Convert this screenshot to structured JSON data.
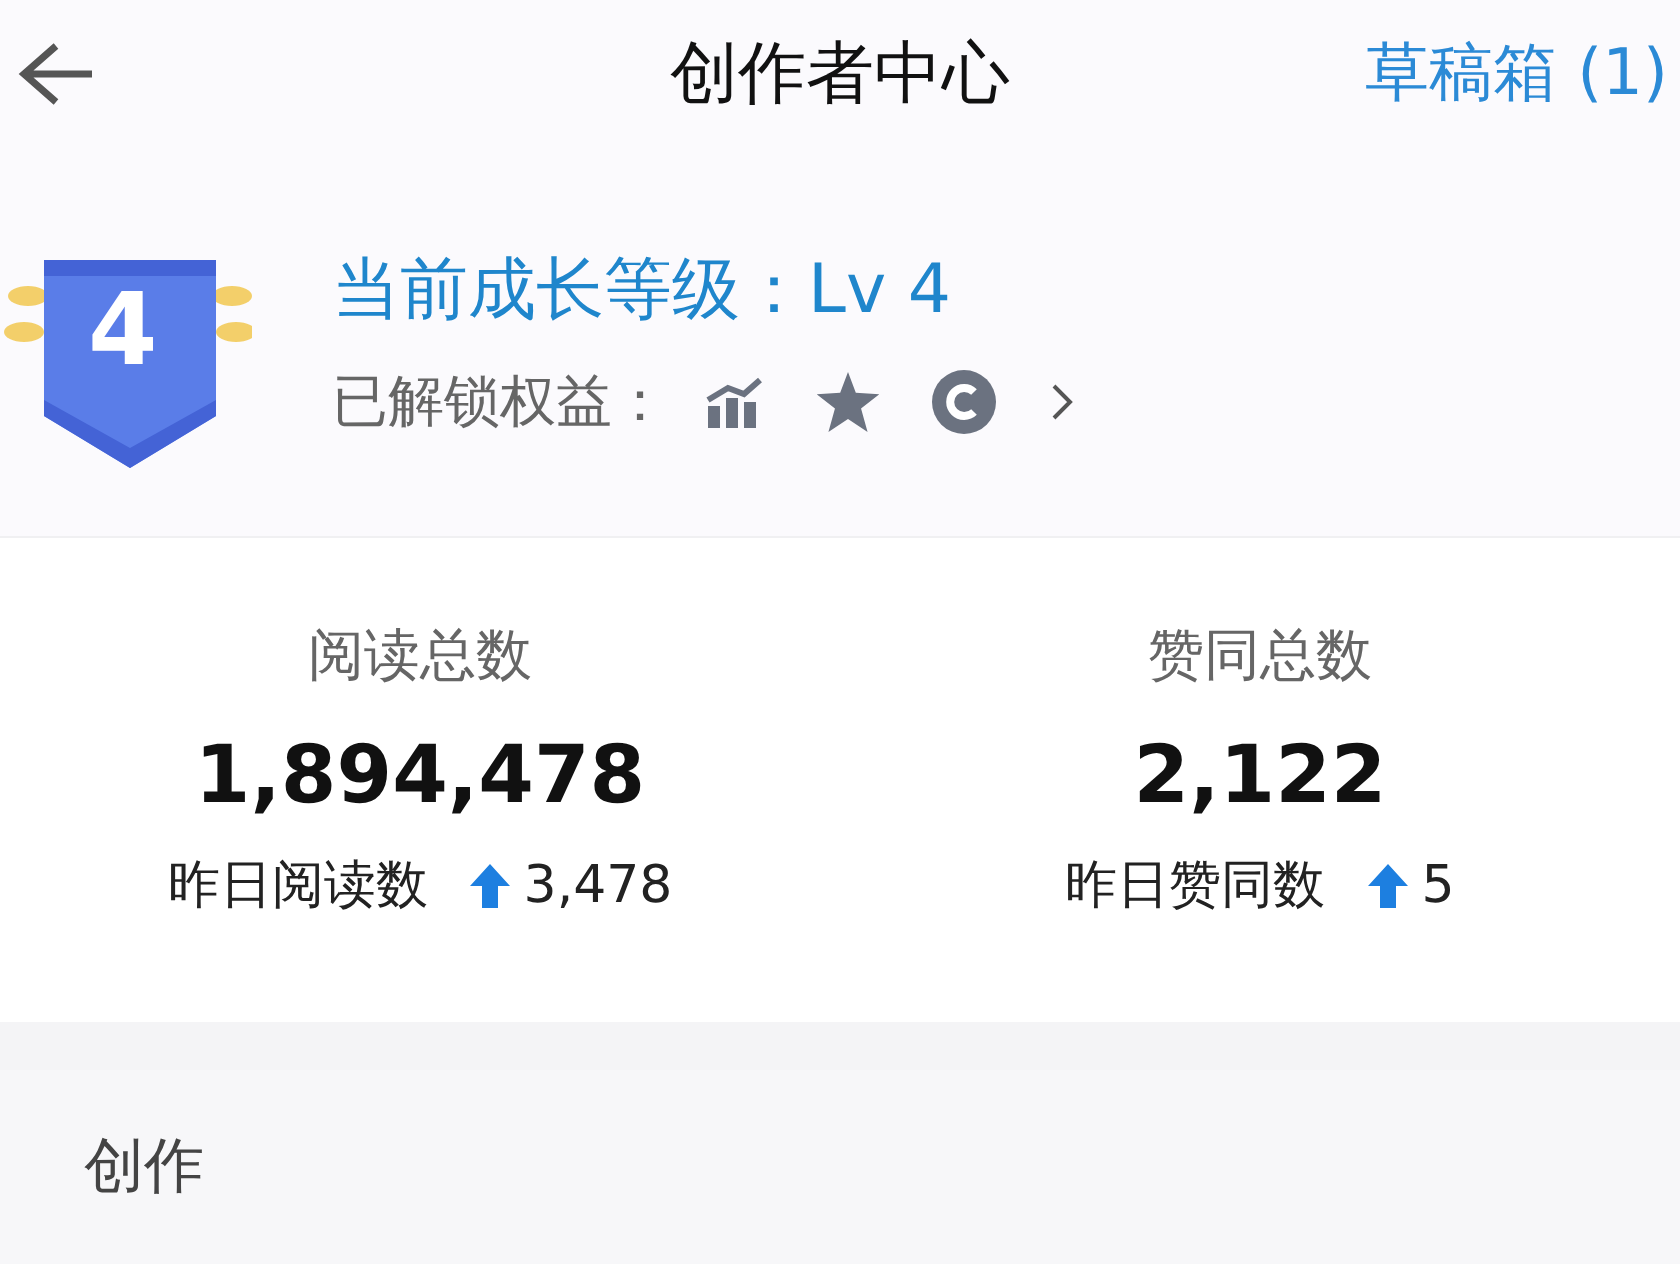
{
  "header": {
    "title": "创作者中心",
    "action": "草稿箱 (1)"
  },
  "level": {
    "badge": "4",
    "title": "当前成长等级：Lv 4",
    "unlocked_label": "已解锁权益："
  },
  "stats": [
    {
      "label": "阅读总数",
      "value": "1,894,478",
      "yesterday_label": "昨日阅读数",
      "yesterday_value": "3,478"
    },
    {
      "label": "赞同总数",
      "value": "2,122",
      "yesterday_label": "昨日赞同数",
      "yesterday_value": "5"
    }
  ],
  "section": {
    "title": "创作"
  }
}
